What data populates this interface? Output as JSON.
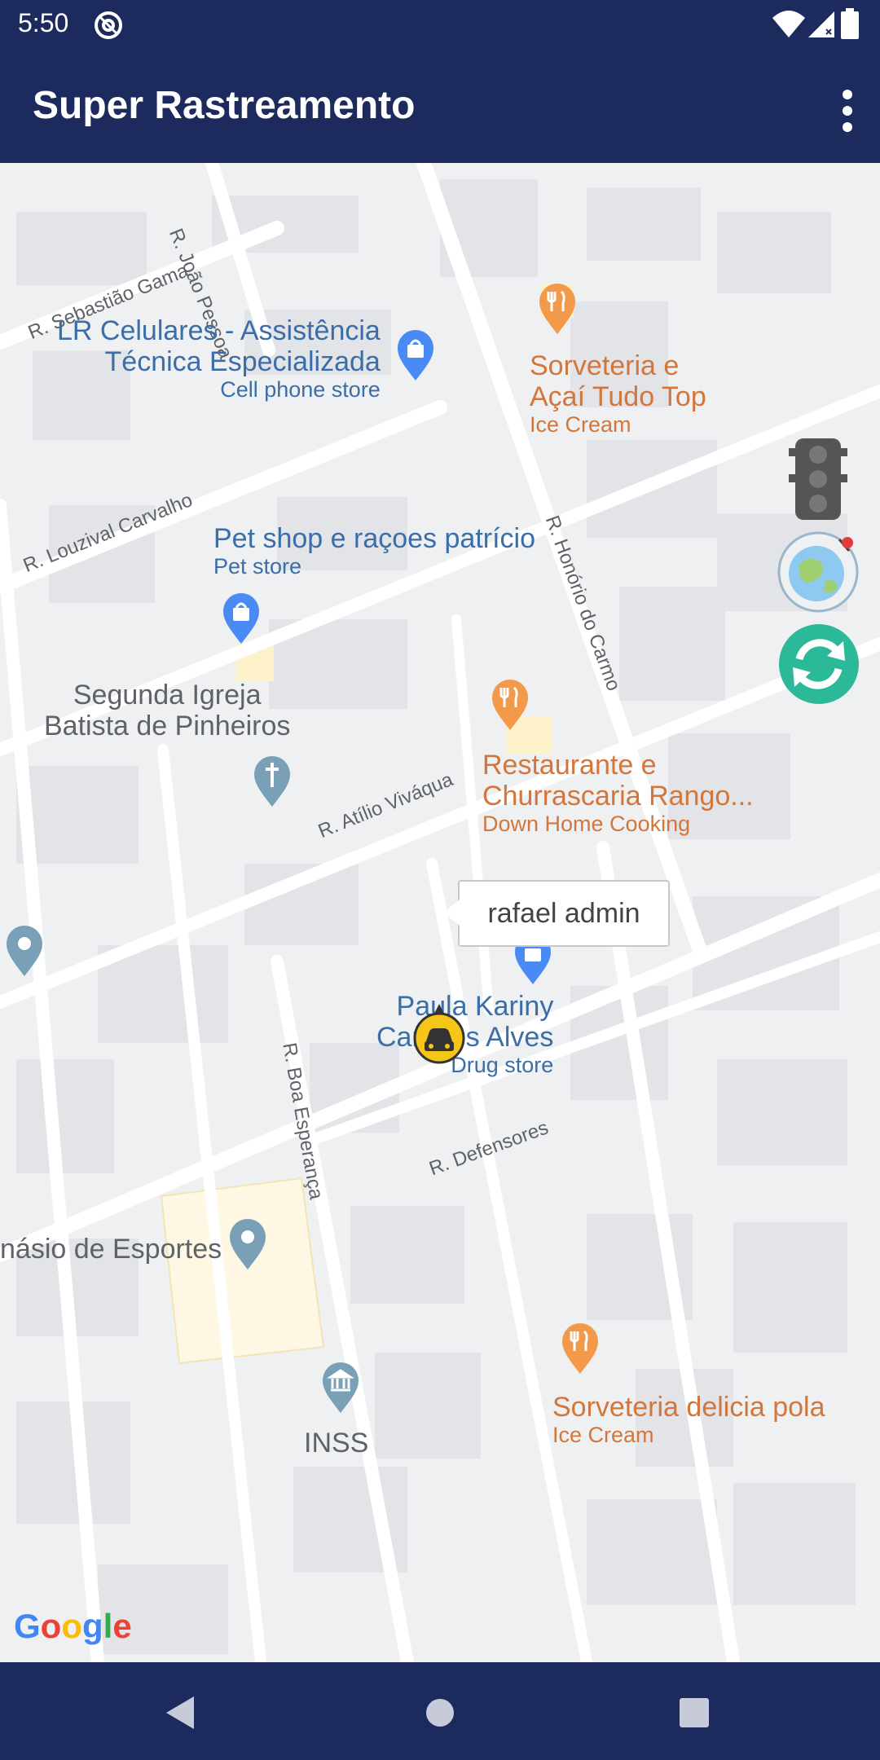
{
  "status_bar": {
    "time": "5:50",
    "icons": [
      "at-sign-icon",
      "wifi-icon",
      "signal-icon"
    ]
  },
  "app_bar": {
    "title": "Super Rastreamento",
    "menu_icon": "more-vert-icon"
  },
  "map": {
    "streets": [
      "R. Sebastião Gama",
      "R. João Pessoa",
      "R. Louzival Carvalho",
      "R. Honório do Carmo",
      "R. Atílio Viváqua",
      "R. Boa Esperança",
      "R. Defensores"
    ],
    "pois": [
      {
        "name_lines": [
          "LR Celulares - Assistência",
          "Técnica Especializada"
        ],
        "category": "Cell phone store",
        "icon": "shopping-bag-icon"
      },
      {
        "name_lines": [
          "Sorveteria e",
          "Açaí Tudo Top"
        ],
        "category": "Ice Cream",
        "icon": "restaurant-icon"
      },
      {
        "name_lines": [
          "Pet shop e raçoes patrício"
        ],
        "category": "Pet store",
        "icon": "shopping-bag-icon"
      },
      {
        "name_lines": [
          "Segunda Igreja",
          "Batista de Pinheiros"
        ],
        "category": "",
        "icon": "church-icon"
      },
      {
        "name_lines": [
          "Restaurante e",
          "Churrascaria Rango..."
        ],
        "category": "Down Home Cooking",
        "icon": "restaurant-icon"
      },
      {
        "name_lines": [
          "Paula Kariny",
          "Campos Alves"
        ],
        "category": "Drug store",
        "icon": "shopping-bag-icon"
      },
      {
        "name_lines": [
          "násio de Esportes"
        ],
        "category": "",
        "icon": "place-pin-icon"
      },
      {
        "name_lines": [
          "INSS"
        ],
        "category": "",
        "icon": "bank-icon"
      },
      {
        "name_lines": [
          "Sorveteria delicia pola"
        ],
        "category": "Ice Cream",
        "icon": "restaurant-icon"
      }
    ],
    "vehicle_marker": {
      "icon": "taxi-icon",
      "info_window": "rafael admin"
    },
    "controls": [
      "traffic-light-icon",
      "globe-icon",
      "refresh-icon"
    ],
    "attribution": "Google"
  },
  "nav_bar": {
    "buttons": [
      "back-icon",
      "home-icon",
      "recents-icon"
    ]
  },
  "colors": {
    "app_bar": "#1c2a5e",
    "poi_blue": "#3b6ea8",
    "poi_orange": "#d3763b",
    "refresh_button": "#2bb99a",
    "taxi_marker": "#f5c518"
  }
}
